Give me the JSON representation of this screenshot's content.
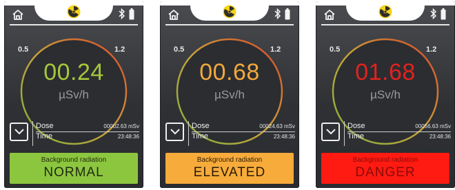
{
  "screens": [
    {
      "reading": "00.24",
      "unit": "µSv/h",
      "scale_min": "0.5",
      "scale_max": "1.2",
      "dose_label": "Dose",
      "dose_value": "00002.63 mSv",
      "time_label": "Time",
      "time_value": "23:48:36",
      "status_caption": "Background radiation",
      "status": "NORMAL",
      "colors": {
        "reading": "#a7c73a",
        "status_bg": "#8cc63f",
        "status_text": "#1f2a10"
      }
    },
    {
      "reading": "00.68",
      "unit": "µSv/h",
      "scale_min": "0.5",
      "scale_max": "1.2",
      "dose_label": "Dose",
      "dose_value": "00024.63 mSv",
      "time_label": "Time",
      "time_value": "23:48:36",
      "status_caption": "Background radiation",
      "status": "ELEVATED",
      "colors": {
        "reading": "#f2a93b",
        "status_bg": "#f7ab3a",
        "status_text": "#2a1a05"
      }
    },
    {
      "reading": "01.68",
      "unit": "µSv/h",
      "scale_min": "0.5",
      "scale_max": "1.2",
      "dose_label": "Dose",
      "dose_value": "00056.63 mSv",
      "time_label": "Time",
      "time_value": "23:48:36",
      "status_caption": "Background radiation",
      "status": "DANGER",
      "colors": {
        "reading": "#e3221d",
        "status_bg": "#ff1a12",
        "status_text": "#8c0a06"
      }
    }
  ],
  "icons": {
    "home": "home-icon",
    "radiation": "radiation-icon",
    "bluetooth": "bluetooth-icon",
    "battery": "battery-icon",
    "expand": "chevron-down-icon"
  }
}
